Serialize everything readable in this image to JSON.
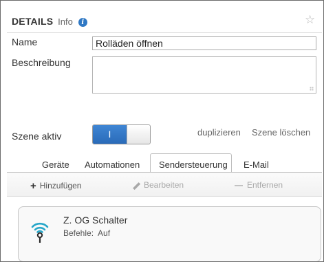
{
  "header": {
    "title": "DETAILS",
    "subtitle": "Info",
    "info_icon_glyph": "i",
    "star_icon_glyph": "☆"
  },
  "form": {
    "name_label": "Name",
    "name_value": "Rolläden öffnen",
    "description_label": "Beschreibung",
    "description_value": "",
    "active_label": "Szene aktiv",
    "toggle_state_label": "I",
    "toggle_on": true
  },
  "actions": {
    "duplicate": "duplizieren",
    "delete_scene": "Szene löschen"
  },
  "tabs": [
    {
      "label": "Geräte",
      "active": false
    },
    {
      "label": "Automationen",
      "active": false
    },
    {
      "label": "Sendersteuerung",
      "active": true
    },
    {
      "label": "E-Mail",
      "active": false
    }
  ],
  "toolbar": {
    "add_label": "Hinzufügen",
    "edit_label": "Bearbeiten",
    "remove_label": "Entfernen"
  },
  "sender_card": {
    "title": "Z. OG Schalter",
    "commands_label": "Befehle:",
    "commands_value": "Auf",
    "icon": "wireless-sender-icon"
  },
  "colors": {
    "accent": "#2f78c4",
    "border": "#6a6a6a",
    "disabled_text": "#a8a8a8"
  }
}
